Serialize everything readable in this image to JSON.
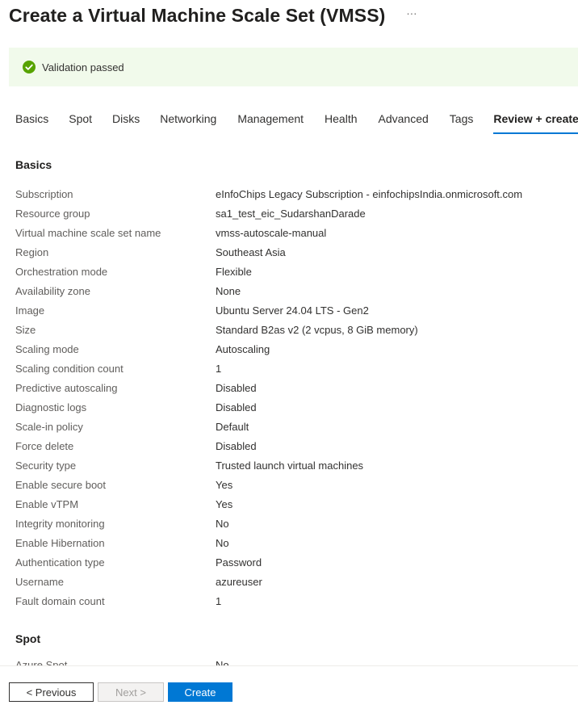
{
  "header": {
    "title": "Create a Virtual Machine Scale Set (VMSS)",
    "more_label": "···"
  },
  "banner": {
    "icon": "check-circle-icon",
    "text": "Validation passed",
    "color": "#57a300"
  },
  "tabs": [
    {
      "label": "Basics",
      "active": false
    },
    {
      "label": "Spot",
      "active": false
    },
    {
      "label": "Disks",
      "active": false
    },
    {
      "label": "Networking",
      "active": false
    },
    {
      "label": "Management",
      "active": false
    },
    {
      "label": "Health",
      "active": false
    },
    {
      "label": "Advanced",
      "active": false
    },
    {
      "label": "Tags",
      "active": false
    },
    {
      "label": "Review + create",
      "active": true
    }
  ],
  "basics": {
    "title": "Basics",
    "rows": [
      {
        "key": "Subscription",
        "value": "eInfoChips Legacy Subscription - einfochipsIndia.onmicrosoft.com"
      },
      {
        "key": "Resource group",
        "value": "sa1_test_eic_SudarshanDarade"
      },
      {
        "key": "Virtual machine scale set name",
        "value": "vmss-autoscale-manual"
      },
      {
        "key": "Region",
        "value": "Southeast Asia"
      },
      {
        "key": "Orchestration mode",
        "value": "Flexible"
      },
      {
        "key": "Availability zone",
        "value": "None"
      },
      {
        "key": "Image",
        "value": "Ubuntu Server 24.04 LTS - Gen2"
      },
      {
        "key": "Size",
        "value": "Standard B2as v2 (2 vcpus, 8 GiB memory)"
      },
      {
        "key": "Scaling mode",
        "value": "Autoscaling"
      },
      {
        "key": "Scaling condition count",
        "value": "1"
      },
      {
        "key": "Predictive autoscaling",
        "value": "Disabled"
      },
      {
        "key": "Diagnostic logs",
        "value": "Disabled"
      },
      {
        "key": "Scale-in policy",
        "value": "Default"
      },
      {
        "key": "Force delete",
        "value": "Disabled"
      },
      {
        "key": "Security type",
        "value": "Trusted launch virtual machines"
      },
      {
        "key": "Enable secure boot",
        "value": "Yes"
      },
      {
        "key": "Enable vTPM",
        "value": "Yes"
      },
      {
        "key": "Integrity monitoring",
        "value": "No"
      },
      {
        "key": "Enable Hibernation",
        "value": "No"
      },
      {
        "key": "Authentication type",
        "value": "Password"
      },
      {
        "key": "Username",
        "value": "azureuser"
      },
      {
        "key": "Fault domain count",
        "value": "1"
      }
    ]
  },
  "spot": {
    "title": "Spot",
    "rows": [
      {
        "key": "Azure Spot",
        "value": "No"
      }
    ]
  },
  "footer": {
    "previous_label": "< Previous",
    "next_label": "Next >",
    "create_label": "Create"
  },
  "colors": {
    "accent": "#0078d4",
    "success_bg": "#f1faeb"
  }
}
